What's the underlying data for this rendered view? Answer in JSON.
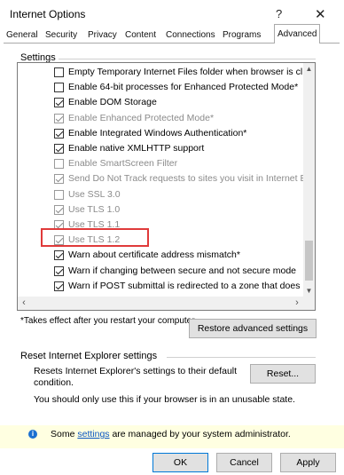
{
  "window": {
    "title": "Internet Options",
    "help_label": "?",
    "close_label": "✕"
  },
  "tabs": [
    {
      "label": "General"
    },
    {
      "label": "Security"
    },
    {
      "label": "Privacy"
    },
    {
      "label": "Content"
    },
    {
      "label": "Connections"
    },
    {
      "label": "Programs"
    },
    {
      "label": "Advanced",
      "active": true
    }
  ],
  "settings": {
    "group_label": "Settings",
    "items": [
      {
        "label": "Empty Temporary Internet Files folder when browser is cl",
        "checked": false,
        "disabled": false
      },
      {
        "label": "Enable 64-bit processes for Enhanced Protected Mode*",
        "checked": false,
        "disabled": false
      },
      {
        "label": "Enable DOM Storage",
        "checked": true,
        "disabled": false
      },
      {
        "label": "Enable Enhanced Protected Mode*",
        "checked": true,
        "disabled": true
      },
      {
        "label": "Enable Integrated Windows Authentication*",
        "checked": true,
        "disabled": false
      },
      {
        "label": "Enable native XMLHTTP support",
        "checked": true,
        "disabled": false
      },
      {
        "label": "Enable SmartScreen Filter",
        "checked": false,
        "disabled": true
      },
      {
        "label": "Send Do Not Track requests to sites you visit in Internet E",
        "checked": true,
        "disabled": true
      },
      {
        "label": "Use SSL 3.0",
        "checked": false,
        "disabled": true
      },
      {
        "label": "Use TLS 1.0",
        "checked": true,
        "disabled": true
      },
      {
        "label": "Use TLS 1.1",
        "checked": true,
        "disabled": true
      },
      {
        "label": "Use TLS 1.2",
        "checked": true,
        "disabled": true
      },
      {
        "label": "Warn about certificate address mismatch*",
        "checked": true,
        "disabled": false
      },
      {
        "label": "Warn if changing between secure and not secure mode",
        "checked": true,
        "disabled": false
      },
      {
        "label": "Warn if POST submittal is redirected to a zone that does n",
        "checked": true,
        "disabled": false
      }
    ],
    "note": "*Takes effect after you restart your computer",
    "restore_button": "Restore advanced settings"
  },
  "reset": {
    "group_label": "Reset Internet Explorer settings",
    "description": "Resets Internet Explorer's settings to their default condition.",
    "button": "Reset...",
    "note": "You should only use this if your browser is in an unusable state."
  },
  "info": {
    "icon": "info-icon",
    "text_before": "Some ",
    "link": "settings",
    "text_after": " are managed by your system administrator."
  },
  "footer": {
    "ok": "OK",
    "cancel": "Cancel",
    "apply": "Apply"
  },
  "colors": {
    "highlight": "#e03a3a",
    "info_bg": "#ffffe1",
    "link": "#0b57c2"
  }
}
